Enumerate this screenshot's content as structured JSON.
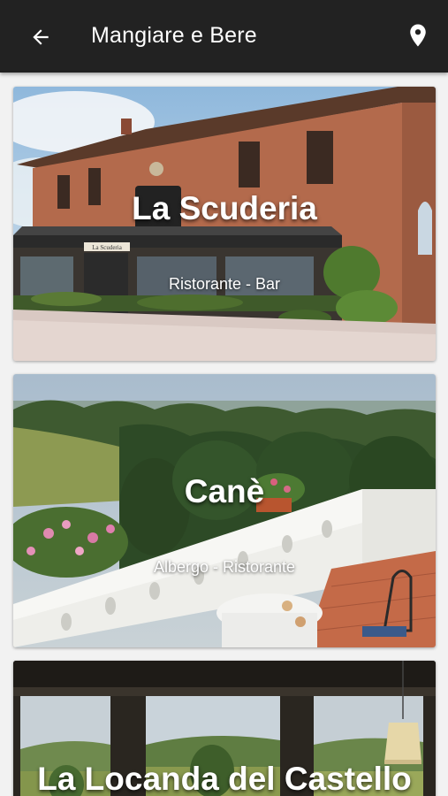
{
  "appbar": {
    "title": "Mangiare e Bere",
    "back_icon": "arrow-back-icon",
    "location_icon": "map-pin-icon",
    "background_color": "#222222"
  },
  "venues": [
    {
      "name": "La Scuderia",
      "category": "Ristorante - Bar"
    },
    {
      "name": "Canè",
      "category": "Albergo - Ristorante"
    },
    {
      "name": "La Locanda del Castello",
      "category": ""
    }
  ],
  "signage": {
    "la_scuderia_sign": "La Scuderia"
  }
}
